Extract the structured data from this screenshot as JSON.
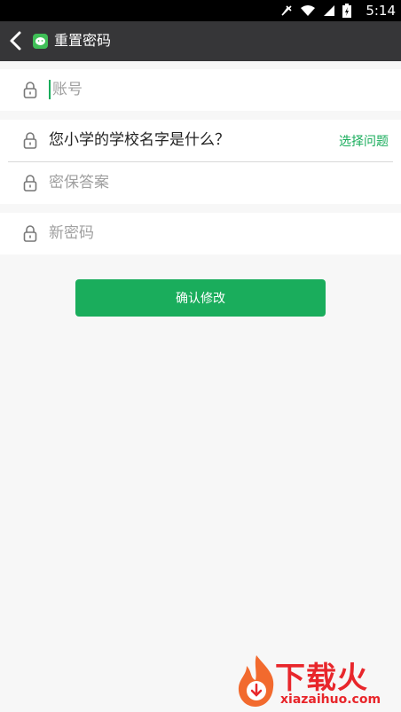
{
  "status_bar": {
    "time": "5:14",
    "icons": [
      "mute-icon",
      "wifi-icon",
      "signal-icon",
      "battery-icon"
    ]
  },
  "header": {
    "title": "重置密码"
  },
  "form": {
    "account_placeholder": "账号",
    "security_question": "您小学的学校名字是什么？",
    "choose_question_label": "选择问题",
    "answer_placeholder": "密保答案",
    "new_password_placeholder": "新密码"
  },
  "confirm_button_label": "确认修改",
  "watermark": {
    "brand": "下载火",
    "url": "xiazaihuo.com"
  },
  "colors": {
    "accent": "#1aad5c",
    "titlebar": "#363638",
    "background": "#f7f7f7"
  }
}
